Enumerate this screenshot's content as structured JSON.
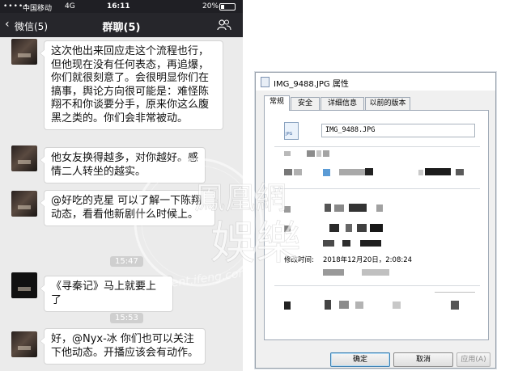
{
  "phone": {
    "status": {
      "signal": "•••••",
      "carrier": "中国移动",
      "network": "4G",
      "time": "16:11",
      "battery": "20%"
    },
    "nav": {
      "back_label": "微信(5)",
      "title": "群聊(5)"
    },
    "messages": [
      {
        "text": "这次他出来回应走这个流程也行，但他现在没有任何表态，再追爆，你们就很刻意了。会很明显你们在搞事，舆论方向很可能是：难怪陈翔不和你谈要分手，原来你这么腹黑之类的。你们会非常被动。"
      },
      {
        "text": "他女友换得越多，对你越好。感情二人转坐的越实。"
      },
      {
        "text": "@好吃的克星 可以了解一下陈翔动态，看看他新剧什么时候上。"
      },
      {
        "text": "《寻秦记》马上就要上了"
      },
      {
        "text": "好，@Nyx-冰 你们也可以关注下他动态。开播应该会有动作。"
      }
    ],
    "timestamps": [
      "15:47",
      "15:53"
    ]
  },
  "dialog": {
    "title": "IMG_9488.JPG 属性",
    "tabs": [
      "常规",
      "安全",
      "详细信息",
      "以前的版本"
    ],
    "filename": "IMG_9488.JPG",
    "date_label": "修改时间:",
    "date_value": "2018年12月20日，2:08:24",
    "buttons": {
      "ok": "确定",
      "cancel": "取消",
      "apply": "应用(A)"
    }
  },
  "watermark": {
    "text_top": "鳳凰網",
    "text_bottom": "娛樂",
    "text_en": "ent.ifeng.com"
  },
  "colors": {
    "wechat_nav": "#26262b",
    "chat_bg": "#ebebeb",
    "dialog_bg": "#f0f0f0"
  }
}
